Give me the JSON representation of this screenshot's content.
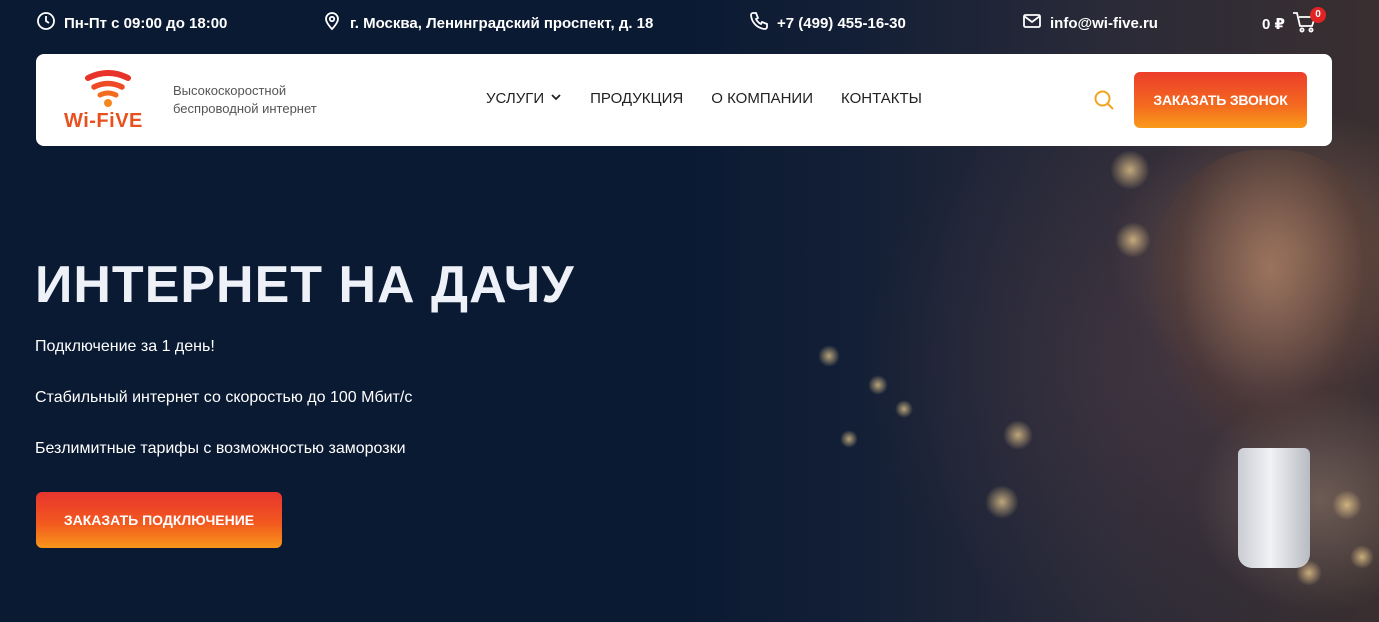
{
  "topbar": {
    "hours": "Пн-Пт с 09:00 до 18:00",
    "address": "г. Москва, Ленинградский проспект, д. 18",
    "phone": "+7 (499) 455-16-30",
    "email": "info@wi-five.ru",
    "cart_total": "0 ₽",
    "cart_count": "0"
  },
  "header": {
    "logo_text": "Wi-FiVE",
    "tagline": "Высокоскоростной беспроводной интернет",
    "nav": [
      "УСЛУГИ",
      "ПРОДУКЦИЯ",
      "О КОМПАНИИ",
      "КОНТАКТЫ"
    ],
    "call_button": "ЗАКАЗАТЬ ЗВОНОК"
  },
  "hero": {
    "title": "ИНТЕРНЕТ НА ДАЧУ",
    "features": [
      "Подключение за 1 день!",
      "Стабильный интернет со скоростью до 100 Мбит/с",
      "Безлимитные тарифы с возможностью заморозки"
    ],
    "cta_button": "ЗАКАЗАТЬ ПОДКЛЮЧЕНИЕ"
  },
  "colors": {
    "background": "#0b1a33",
    "accent_orange": "#f46a1f",
    "accent_red": "#e8352f",
    "search_icon": "#f2a41e"
  },
  "icons": [
    "clock-icon",
    "location-icon",
    "phone-icon",
    "mail-icon",
    "cart-icon",
    "chevron-down-icon",
    "search-icon",
    "wifi-logo-icon"
  ]
}
